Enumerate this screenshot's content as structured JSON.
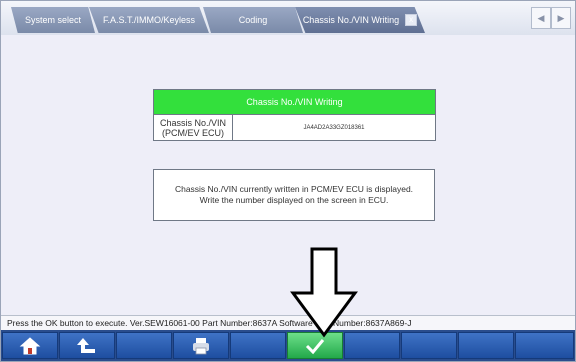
{
  "tabs": [
    {
      "label": "System select",
      "active": false
    },
    {
      "label": "F.A.S.T./IMMO/Keyless",
      "active": false
    },
    {
      "label": "Coding",
      "active": false
    },
    {
      "label": "Chassis No./VIN Writing",
      "active": true
    }
  ],
  "tab_close_label": "x",
  "vin_table": {
    "header": "Chassis No./VIN Writing",
    "label_line1": "Chassis No./VIN",
    "label_line2": "(PCM/EV ECU)",
    "value": "JA4AD2A33GZ018361"
  },
  "message": {
    "line1": "Chassis No./VIN currently written in PCM/EV ECU is displayed.",
    "line2": "Write the number displayed on the screen in ECU."
  },
  "status_text": "Press the OK button to execute.  Ver.SEW16061-00 Part Number:8637A          Software Part Number:8637A869-J",
  "colors": {
    "header_green": "#33e03c",
    "toolbar_blue": "#2a4d8d",
    "ok_green": "#22a84a"
  },
  "toolbar_icons": [
    "home-icon",
    "back-icon",
    "blank",
    "print-icon",
    "blank",
    "checkmark-icon",
    "blank",
    "blank",
    "blank",
    "blank"
  ]
}
